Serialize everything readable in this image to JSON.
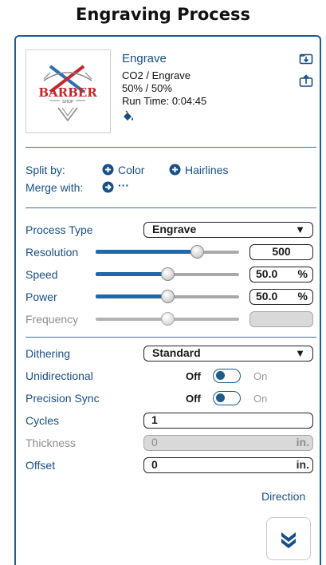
{
  "page": {
    "title": "Engraving Process"
  },
  "layer": {
    "name": "Engrave",
    "material": "CO2 / Engrave",
    "power_speed": "50% / 50%",
    "run_time": "Run Time: 0:04:45",
    "thumbnail_text": "BARBER",
    "thumbnail_subtext": "SHOP",
    "icons": [
      "paint-bucket-icon",
      "import-icon",
      "export-icon"
    ]
  },
  "split": {
    "label": "Split by:",
    "color_label": "Color",
    "hairlines_label": "Hairlines",
    "merge_label": "Merge with:",
    "merge_more": "···"
  },
  "settings": {
    "process_type": {
      "label": "Process Type",
      "value": "Engrave",
      "arrow": "▼"
    },
    "resolution": {
      "label": "Resolution",
      "value": "500",
      "slider_fraction": 0.73
    },
    "speed": {
      "label": "Speed",
      "value": "50.0",
      "unit": "%",
      "slider_fraction": 0.5
    },
    "power": {
      "label": "Power",
      "value": "50.0",
      "unit": "%",
      "slider_fraction": 0.5
    },
    "frequency": {
      "label": "Frequency",
      "value": "",
      "slider_fraction": 0.5
    }
  },
  "options": {
    "dithering": {
      "label": "Dithering",
      "value": "Standard",
      "arrow": "▼"
    },
    "unidirectional": {
      "label": "Unidirectional",
      "off": "Off",
      "on": "On",
      "state": "off"
    },
    "precision_sync": {
      "label": "Precision Sync",
      "off": "Off",
      "on": "On",
      "state": "off"
    },
    "cycles": {
      "label": "Cycles",
      "value": "1"
    },
    "thickness": {
      "label": "Thickness",
      "value": "0",
      "unit": "in."
    },
    "offset": {
      "label": "Offset",
      "value": "0",
      "unit": "in."
    }
  },
  "direction": {
    "label": "Direction",
    "icon": "double-chevron-down-icon"
  },
  "colors": {
    "accent": "#174f86",
    "panel_border": "#1d5c8c",
    "disabled": "#8c8c8c"
  }
}
